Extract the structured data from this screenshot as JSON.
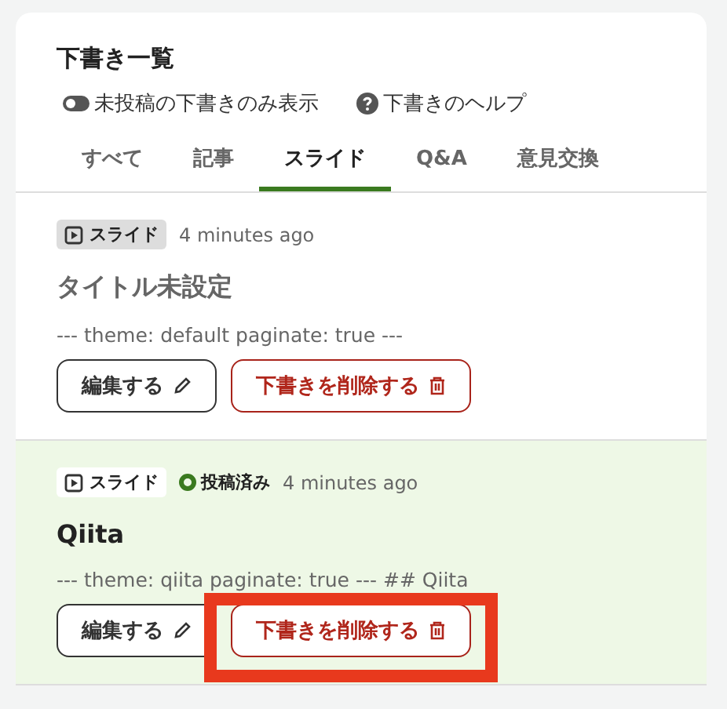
{
  "header": {
    "title": "下書き一覧"
  },
  "filters": {
    "toggle": {
      "label": "未投稿の下書きのみ表示",
      "on": false
    },
    "help": {
      "label": "下書きのヘルプ"
    }
  },
  "tabs": [
    {
      "label": "すべて",
      "selected": false
    },
    {
      "label": "記事",
      "selected": false
    },
    {
      "label": "スライド",
      "selected": true
    },
    {
      "label": "Q&A",
      "selected": false
    },
    {
      "label": "意見交換",
      "selected": false
    }
  ],
  "drafts": [
    {
      "type_label": "スライド",
      "posted": false,
      "time": "4 minutes ago",
      "title": "タイトル未設定",
      "title_placeholder": true,
      "excerpt": "--- theme: default paginate: true ---",
      "buttons": [
        {
          "kind": "edit",
          "label": "編集する",
          "highlighted": false
        },
        {
          "kind": "delete",
          "label": "下書きを削除する",
          "highlighted": false
        }
      ]
    },
    {
      "type_label": "スライド",
      "posted": true,
      "status": "投稿済み",
      "time": "4 minutes ago",
      "title": "Qiita",
      "title_placeholder": false,
      "excerpt": "--- theme: qiita paginate: true --- ## Qiita",
      "buttons": [
        {
          "kind": "edit",
          "label": "編集する",
          "highlighted": false
        },
        {
          "kind": "delete",
          "label": "下書きを削除する",
          "highlighted": true
        }
      ]
    }
  ]
}
